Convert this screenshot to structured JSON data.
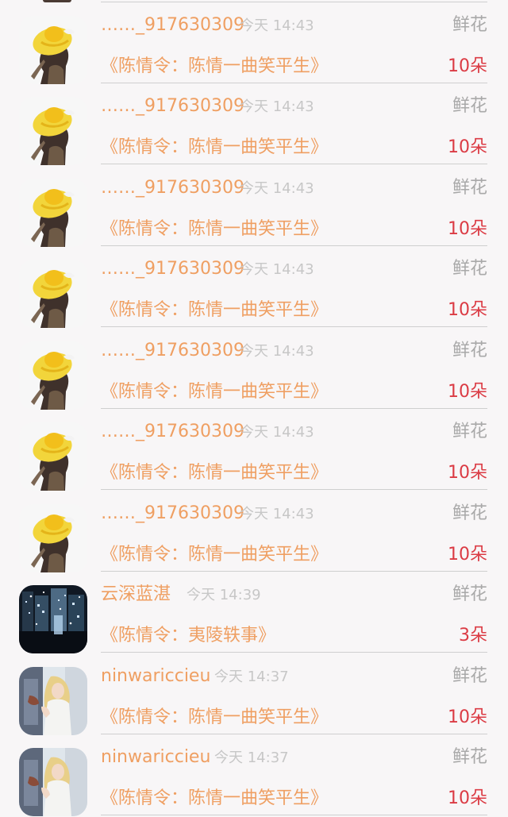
{
  "rows": [
    {
      "username": "……_917630309",
      "time": "今天 14:43",
      "gift_type": "鲜花",
      "title": "《陈情令：陈情一曲笑平生》",
      "amount": "10朵",
      "avatar_icon": "hat-girl-avatar",
      "accent_color": "#ef9f62",
      "amount_color": "#db3b44"
    },
    {
      "username": "……_917630309",
      "time": "今天 14:43",
      "gift_type": "鲜花",
      "title": "《陈情令：陈情一曲笑平生》",
      "amount": "10朵",
      "avatar_icon": "hat-girl-avatar",
      "accent_color": "#ef9f62",
      "amount_color": "#db3b44"
    },
    {
      "username": "……_917630309",
      "time": "今天 14:43",
      "gift_type": "鲜花",
      "title": "《陈情令：陈情一曲笑平生》",
      "amount": "10朵",
      "avatar_icon": "hat-girl-avatar",
      "accent_color": "#ef9f62",
      "amount_color": "#db3b44"
    },
    {
      "username": "……_917630309",
      "time": "今天 14:43",
      "gift_type": "鲜花",
      "title": "《陈情令：陈情一曲笑平生》",
      "amount": "10朵",
      "avatar_icon": "hat-girl-avatar",
      "accent_color": "#ef9f62",
      "amount_color": "#db3b44"
    },
    {
      "username": "……_917630309",
      "time": "今天 14:43",
      "gift_type": "鲜花",
      "title": "《陈情令：陈情一曲笑平生》",
      "amount": "10朵",
      "avatar_icon": "hat-girl-avatar",
      "accent_color": "#ef9f62",
      "amount_color": "#db3b44"
    },
    {
      "username": "……_917630309",
      "time": "今天 14:43",
      "gift_type": "鲜花",
      "title": "《陈情令：陈情一曲笑平生》",
      "amount": "10朵",
      "avatar_icon": "hat-girl-avatar",
      "accent_color": "#ef9f62",
      "amount_color": "#db3b44"
    },
    {
      "username": "……_917630309",
      "time": "今天 14:43",
      "gift_type": "鲜花",
      "title": "《陈情令：陈情一曲笑平生》",
      "amount": "10朵",
      "avatar_icon": "hat-girl-avatar",
      "accent_color": "#ef9f62",
      "amount_color": "#db3b44"
    },
    {
      "username": "云深蓝湛",
      "time": "今天 14:39",
      "gift_type": "鲜花",
      "title": "《陈情令：夷陵轶事》",
      "amount": "3朵",
      "avatar_icon": "city-night-avatar",
      "accent_color": "#ef9f62",
      "amount_color": "#db3b44"
    },
    {
      "username": "ninwariccieu",
      "time": "今天 14:37",
      "gift_type": "鲜花",
      "title": "《陈情令：陈情一曲笑平生》",
      "amount": "10朵",
      "avatar_icon": "blonde-woman-avatar",
      "accent_color": "#ef9f62",
      "amount_color": "#db3b44"
    },
    {
      "username": "ninwariccieu",
      "time": "今天 14:37",
      "gift_type": "鲜花",
      "title": "《陈情令：陈情一曲笑平生》",
      "amount": "10朵",
      "avatar_icon": "blonde-woman-avatar",
      "accent_color": "#ef9f62",
      "amount_color": "#db3b44"
    }
  ]
}
